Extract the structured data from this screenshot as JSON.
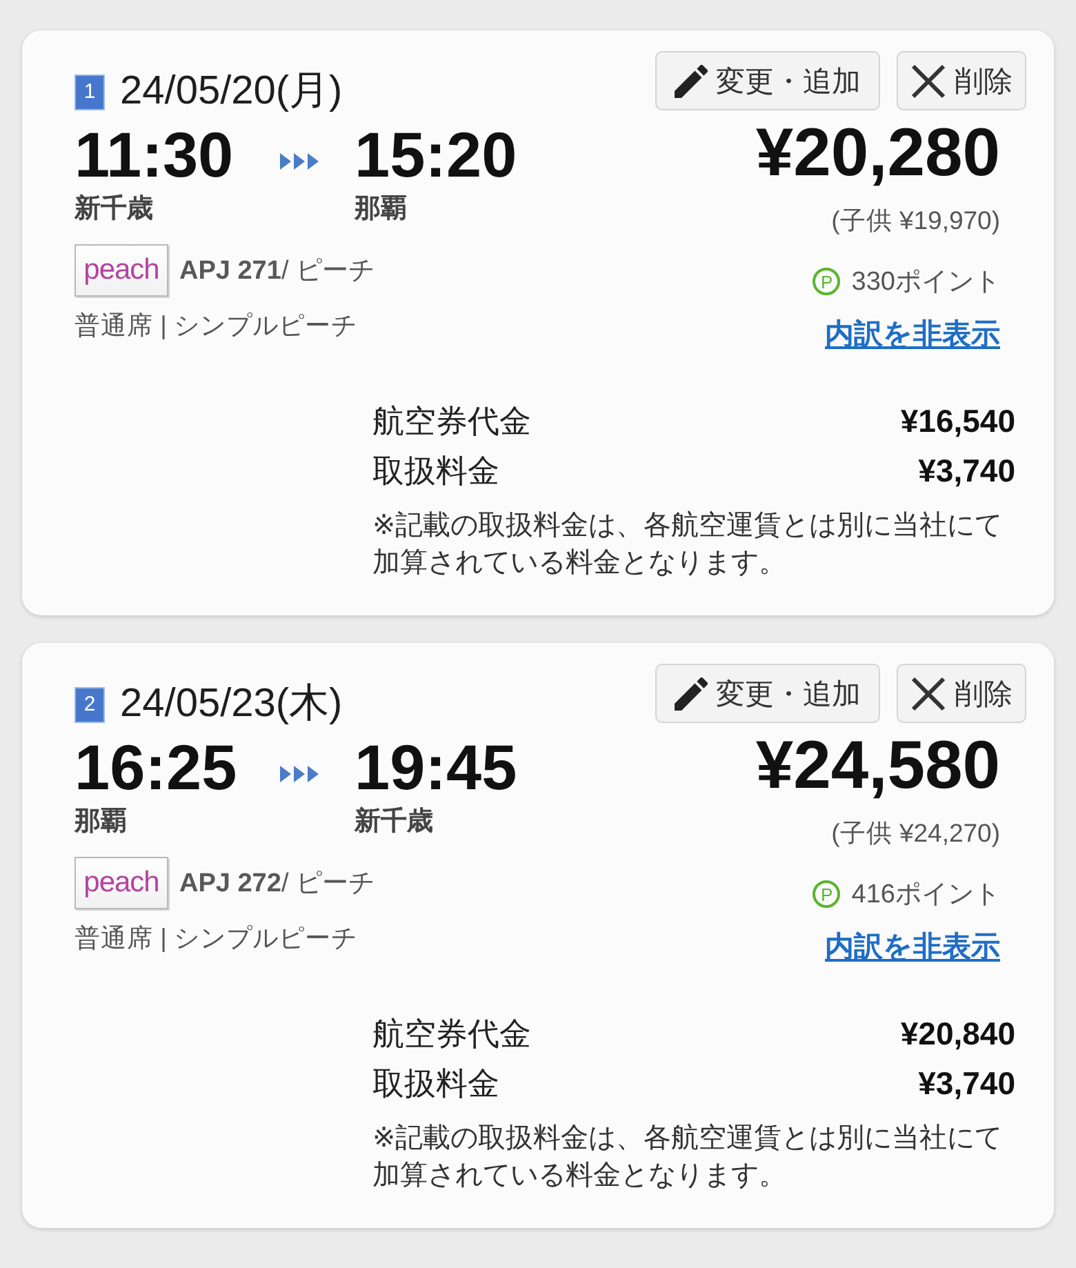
{
  "legs": [
    {
      "number": "1",
      "date": "24/05/20(月)",
      "departure": {
        "time": "11:30",
        "airport": "新千歳"
      },
      "arrival": {
        "time": "15:20",
        "airport": "那覇"
      },
      "airline_logo": "peach",
      "flight": "**APJ 271**/ ピーチ",
      "fare_class": "普通席 | シンプルピーチ",
      "buttons": [
        {
          "kind": "edit",
          "label": "変更・追加"
        },
        {
          "kind": "delete",
          "label": "削除"
        }
      ],
      "price": "¥20,280",
      "child_price": "(子供 ¥19,970)",
      "points": {
        "mark": "P",
        "text": "330ポイント"
      },
      "breakdown_link": "内訳を非表示",
      "breakdown": [
        {
          "label": "航空券代金",
          "amount": "¥16,540"
        },
        {
          "label": "取扱料金",
          "amount": "¥3,740"
        }
      ],
      "note": "※記載の取扱料金は、各航空運賃とは別に当社にて加算されている料金となります。"
    },
    {
      "number": "2",
      "date": "24/05/23(木)",
      "departure": {
        "time": "16:25",
        "airport": "那覇"
      },
      "arrival": {
        "time": "19:45",
        "airport": "新千歳"
      },
      "airline_logo": "peach",
      "flight": "**APJ 272**/ ピーチ",
      "fare_class": "普通席 | シンプルピーチ",
      "buttons": [
        {
          "kind": "edit",
          "label": "変更・追加"
        },
        {
          "kind": "delete",
          "label": "削除"
        }
      ],
      "price": "¥24,580",
      "child_price": "(子供 ¥24,270)",
      "points": {
        "mark": "P",
        "text": "416ポイント"
      },
      "breakdown_link": "内訳を非表示",
      "breakdown": [
        {
          "label": "航空券代金",
          "amount": "¥20,840"
        },
        {
          "label": "取扱料金",
          "amount": "¥3,740"
        }
      ],
      "note": "※記載の取扱料金は、各航空運賃とは別に当社にて加算されている料金となります。"
    }
  ]
}
